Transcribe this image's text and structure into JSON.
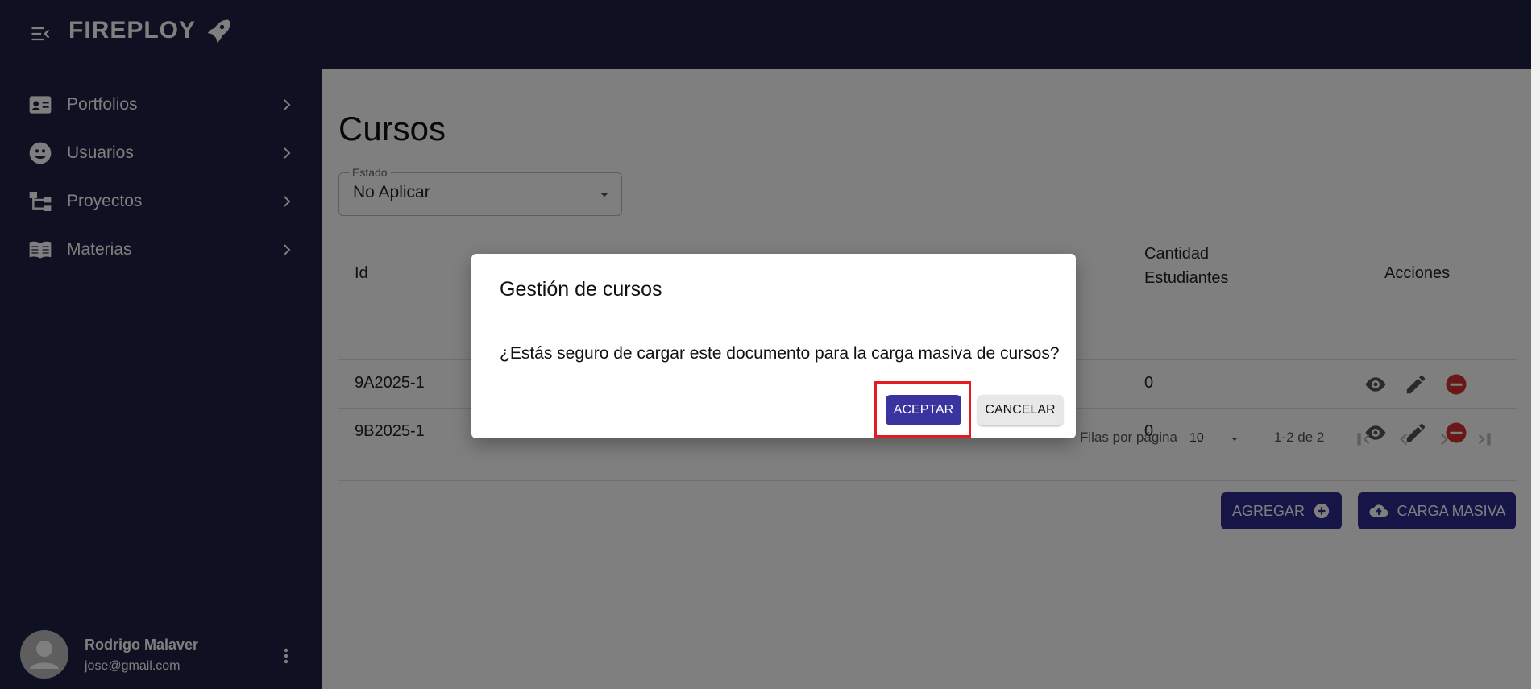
{
  "app": {
    "brand": "FIREPLOY"
  },
  "sidebar": {
    "items": [
      {
        "label": "Portfolios",
        "icon": "id-card-icon"
      },
      {
        "label": "Usuarios",
        "icon": "users-face-icon"
      },
      {
        "label": "Proyectos",
        "icon": "hierarchy-icon"
      },
      {
        "label": "Materias",
        "icon": "book-icon"
      }
    ],
    "user": {
      "name": "Rodrigo Malaver",
      "email": "jose@gmail.com"
    }
  },
  "main": {
    "title": "Cursos",
    "filter": {
      "label": "Estado",
      "value": "No Aplicar"
    },
    "table": {
      "headers": {
        "id": "Id",
        "students": "Cantidad Estudiantes",
        "actions": "Acciones"
      },
      "rows": [
        {
          "id": "9A2025-1",
          "students": "0"
        },
        {
          "id": "9B2025-1",
          "students": "0"
        }
      ]
    },
    "pagination": {
      "rows_per_page_label": "Filas por página",
      "rows_per_page": "10",
      "range": "1-2 de 2"
    },
    "buttons": {
      "add": "AGREGAR",
      "bulk": "CARGA MASIVA"
    }
  },
  "dialog": {
    "title": "Gestión de cursos",
    "message": "¿Estás seguro de cargar este documento para la carga masiva de cursos?",
    "accept": "ACEPTAR",
    "cancel": "CANCELAR"
  },
  "colors": {
    "sidebar": "#1f2244",
    "primary": "#2f2a8f",
    "danger": "#d32f2f",
    "highlight": "#e41b23"
  }
}
